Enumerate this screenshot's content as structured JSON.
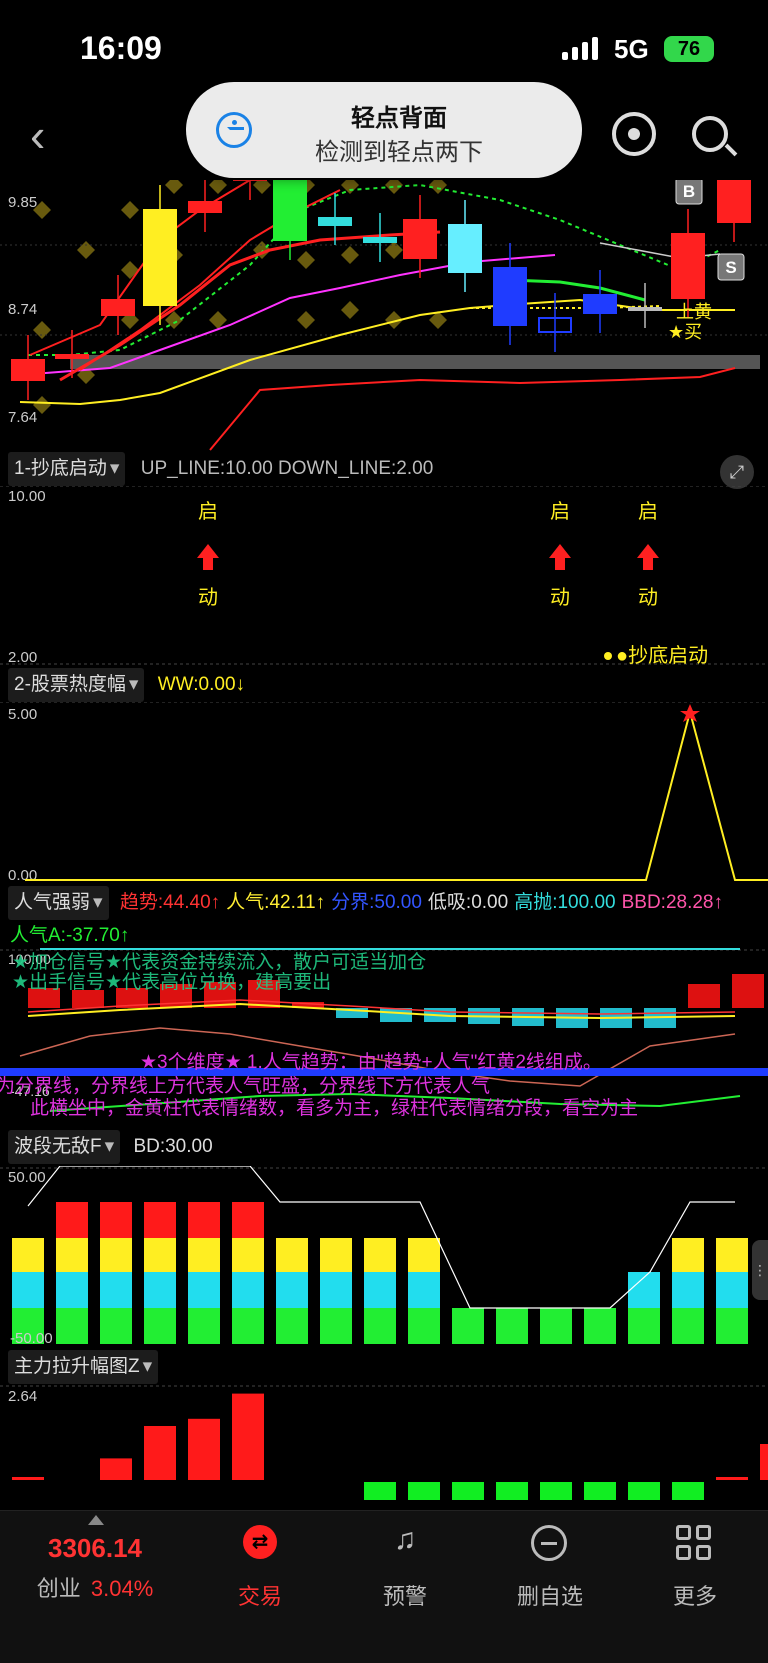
{
  "status_bar": {
    "time": "16:09",
    "network": "5G",
    "battery": "76"
  },
  "toast": {
    "title": "轻点背面",
    "subtitle": "检测到轻点两下"
  },
  "nav": {
    "back_icon": "chevron-left-icon",
    "mascot_icon": "mascot-icon",
    "search_icon": "search-icon"
  },
  "price_chart": {
    "y_labels": [
      "9.85",
      "8.74",
      "7.64"
    ],
    "markers": {
      "b": "B",
      "s": "S",
      "up_yellow": "上黄",
      "buy": "★买"
    }
  },
  "panel1": {
    "name": "1-抄底启动",
    "params": "UP_LINE:10.00 DOWN_LINE:2.00",
    "y_top": "10.00",
    "y_bottom": "2.00",
    "start_label": "启",
    "move_label": "动",
    "legend": "●抄底启动",
    "signal_columns": [
      4,
      12,
      14,
      19
    ]
  },
  "panel2": {
    "name": "2-股票热度幅",
    "ww": "WW:0.00↓",
    "y_top": "5.00",
    "y_bottom": "0.00",
    "peak_column": 19,
    "peak_value": 5.0
  },
  "panel3": {
    "name": "人气强弱",
    "indicators": [
      {
        "label": "趋势:44.40↑",
        "color": "#ff3333"
      },
      {
        "label": "人气:42.11↑",
        "color": "#ffee33"
      },
      {
        "label": "分界:50.00",
        "color": "#3355ff"
      },
      {
        "label": "低吸:0.00",
        "color": "#dddddd"
      },
      {
        "label": "高抛:100.00",
        "color": "#33dddd"
      },
      {
        "label": "BBD:28.28↑",
        "color": "#ff55aa"
      }
    ],
    "line2": "人气A:-37.70↑",
    "y_top": "100.00",
    "y_bottom": "-47.16",
    "overlay_top_a": "★加仓信号★代表资金持续流入，散户可适当加仓",
    "overlay_top_b": "★出手信号★代表高位兑换，建高要出",
    "overlay_mid": "★3个维度★ 1.人气趋势：由\"趋势+人气\"红黄2线组成。",
    "overlay_bottom_a": "为分界线，分界线上方代表人气旺盛，分界线下方代表人气",
    "overlay_bottom_b": "此横坐中，金黄柱代表情绪数，看多为主，绿柱代表情绪分段，看空为主"
  },
  "panel4": {
    "name": "波段无敌F",
    "bd": "BD:30.00",
    "y_top": "50.00",
    "y_bottom": "-50.00"
  },
  "panel5": {
    "name": "主力拉升幅图Z",
    "y_top": "2.64",
    "values": [
      0.08,
      0,
      0.6,
      1.5,
      1.7,
      2.4,
      0,
      0,
      -0.5,
      -0.5,
      -0.5,
      -0.5,
      -0.5,
      -0.5,
      -0.5,
      -0.5,
      0.05,
      1.0
    ]
  },
  "tabbar": {
    "index_value": "3306.14",
    "index_name": "创业",
    "index_change": "3.04%",
    "tabs": [
      {
        "label": "交易",
        "icon": "exchange-icon",
        "active": true
      },
      {
        "label": "预警",
        "icon": "bell-icon",
        "active": false
      },
      {
        "label": "删自选",
        "icon": "minus-circle-icon",
        "active": false
      },
      {
        "label": "更多",
        "icon": "grid-icon",
        "active": false
      }
    ]
  }
}
